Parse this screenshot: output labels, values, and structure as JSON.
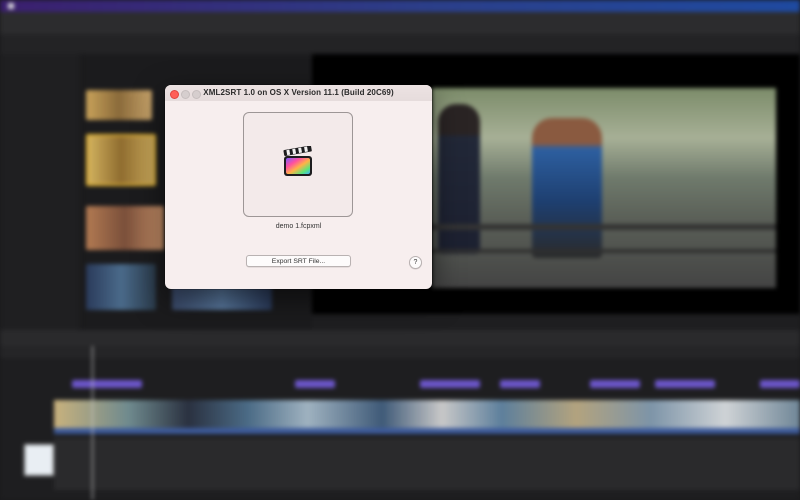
{
  "dialog": {
    "title": "XML2SRT 1.0 on OS X Version 11.1 (Build 20C69)",
    "drop_icon": "final-cut-pro-clapperboard-icon",
    "filename": "demo 1.fcpxml",
    "export_label": "Export SRT File...",
    "help_label": "?"
  },
  "colors": {
    "dialog_bg": "#f7eeee",
    "close_button": "#ff5f57",
    "timeline_markers": "#6b55c8"
  }
}
